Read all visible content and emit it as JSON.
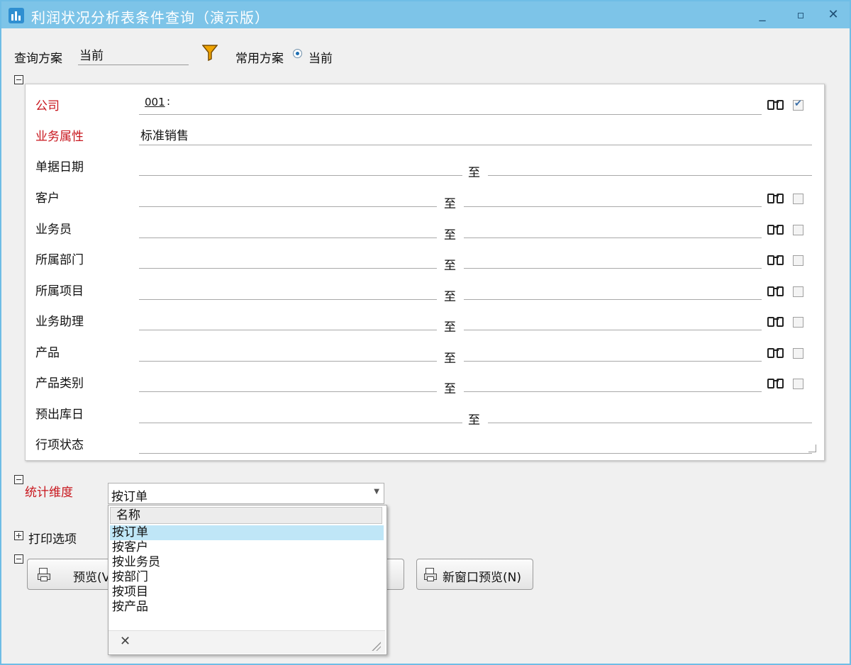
{
  "window": {
    "title": "利润状况分析表条件查询（演示版）",
    "minimize": "_",
    "maximize": "▫",
    "close": "✕"
  },
  "scheme": {
    "label": "查询方案",
    "value": "当前",
    "common_label": "常用方案",
    "common_value": "当前"
  },
  "filters": {
    "company": {
      "label": "公司",
      "value": "001",
      "suffix": ":"
    },
    "business_attr": {
      "label": "业务属性",
      "value": "标准销售"
    },
    "rows": [
      {
        "label": "单据日期",
        "to": "至"
      },
      {
        "label": "客户",
        "to": "至"
      },
      {
        "label": "业务员",
        "to": "至"
      },
      {
        "label": "所属部门",
        "to": "至"
      },
      {
        "label": "所属项目",
        "to": "至"
      },
      {
        "label": "业务助理",
        "to": "至"
      },
      {
        "label": "产品",
        "to": "至"
      },
      {
        "label": "产品类别",
        "to": "至"
      },
      {
        "label": "预出库日",
        "to": "至"
      },
      {
        "label": "行项状态"
      }
    ]
  },
  "stats": {
    "label": "统计维度",
    "value": "按订单",
    "dropdown": {
      "header": "名称",
      "options": [
        "按订单",
        "按客户",
        "按业务员",
        "按部门",
        "按项目",
        "按产品"
      ],
      "close": "✕"
    }
  },
  "print": {
    "label": "打印选项"
  },
  "buttons": {
    "preview": "预览(V",
    "new_window_preview": "新窗口预览(N)"
  },
  "colors": {
    "titlebar": "#7dc4e8",
    "required_label": "#c8161d",
    "selected": "#bfe6f7"
  }
}
